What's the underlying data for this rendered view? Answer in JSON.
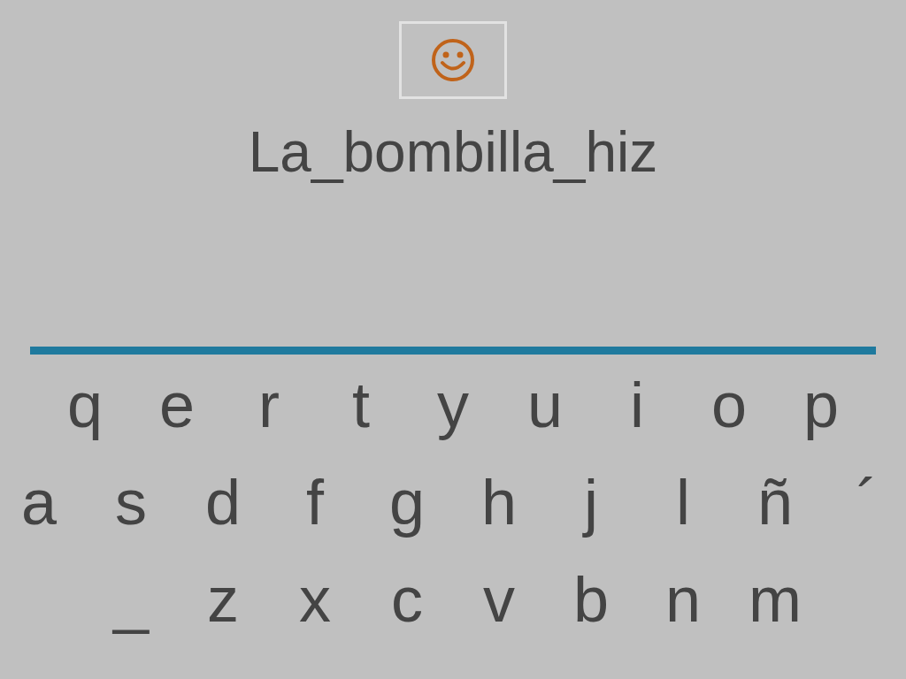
{
  "answer": {
    "text": "La_bombilla_hiz"
  },
  "keyboard": {
    "rows": [
      [
        "q",
        "e",
        "r",
        "t",
        "y",
        "u",
        "i",
        "o",
        "p"
      ],
      [
        "a",
        "s",
        "d",
        "f",
        "g",
        "h",
        "j",
        "l",
        "ñ",
        "´"
      ],
      [
        "_",
        "z",
        "x",
        "c",
        "v",
        "b",
        "n",
        "m"
      ]
    ]
  }
}
